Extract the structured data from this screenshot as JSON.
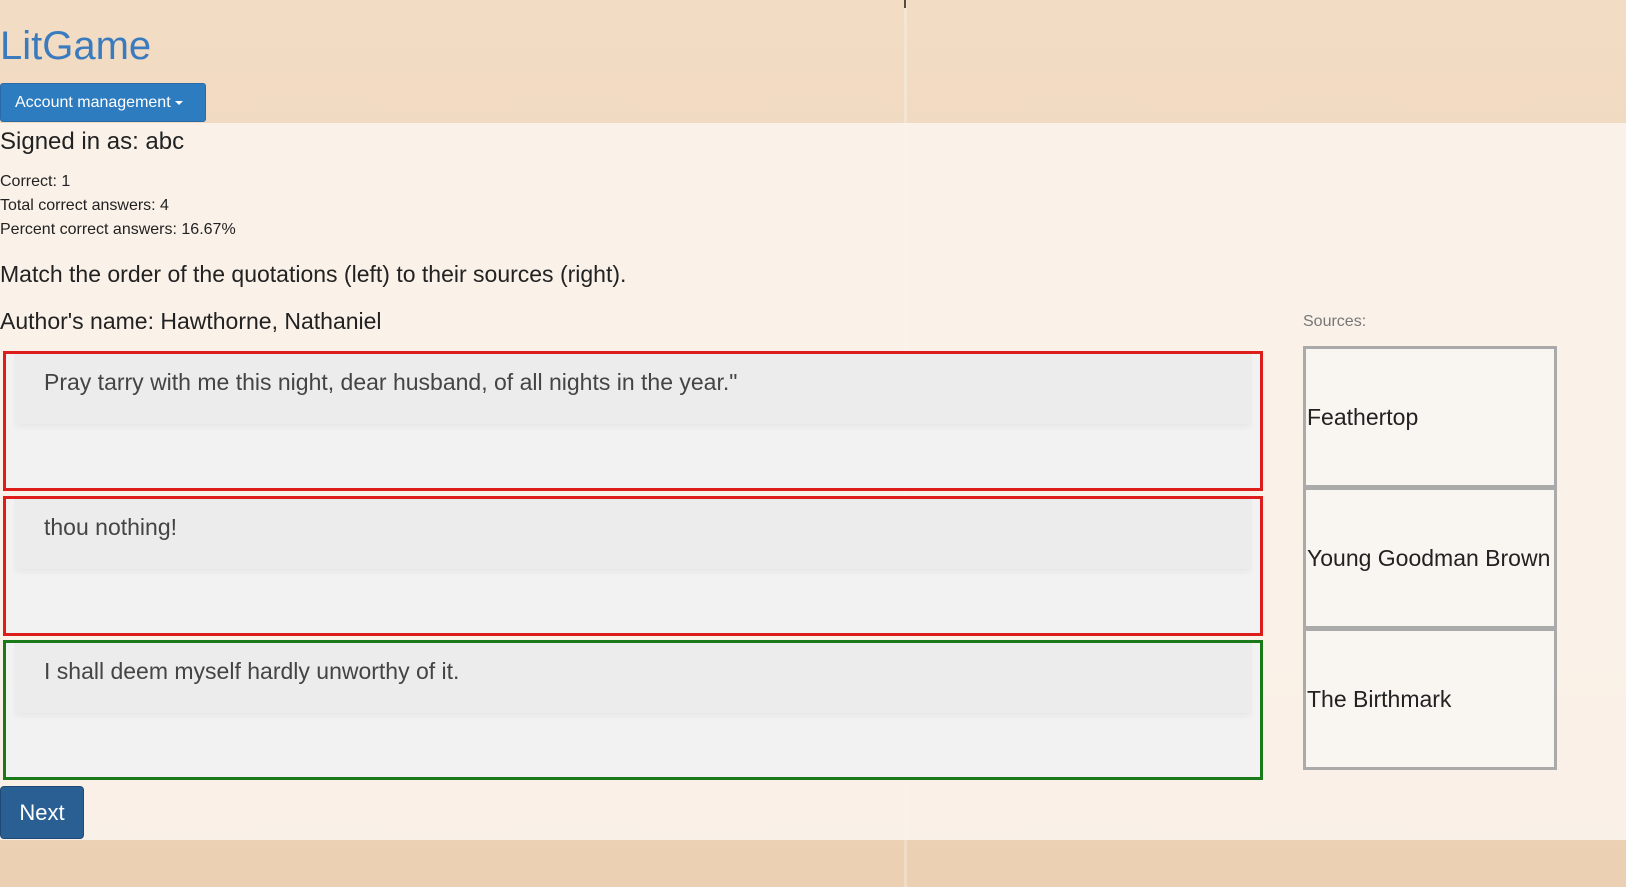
{
  "app": {
    "brand": "LitGame"
  },
  "account": {
    "menu_label": "Account management",
    "signed_in_text": "Signed in as: abc"
  },
  "stats": {
    "correct": "Correct: 1",
    "total_correct": "Total correct answers: 4",
    "percent_correct": "Percent correct answers: 16.67%"
  },
  "game": {
    "instructions": "Match the order of the quotations (left) to their sources (right).",
    "author": "Author's name: Hawthorne, Nathaniel",
    "quotes": [
      {
        "text": "Pray tarry with me this night, dear husband, of all nights in the year.\"",
        "status": "incorrect"
      },
      {
        "text": "thou nothing!",
        "status": "incorrect"
      },
      {
        "text": "I shall deem myself hardly unworthy of it.",
        "status": "correct"
      }
    ],
    "sources_label": "Sources:",
    "sources": [
      "Feathertop",
      "Young Goodman Brown",
      "The Birthmark"
    ],
    "next_label": "Next"
  },
  "colors": {
    "brand": "#3a7bbf",
    "incorrect_border": "#dd1c1c",
    "correct_border": "#1a7a1a",
    "primary_button": "#2e7cc0",
    "next_button": "#2a5f94"
  }
}
